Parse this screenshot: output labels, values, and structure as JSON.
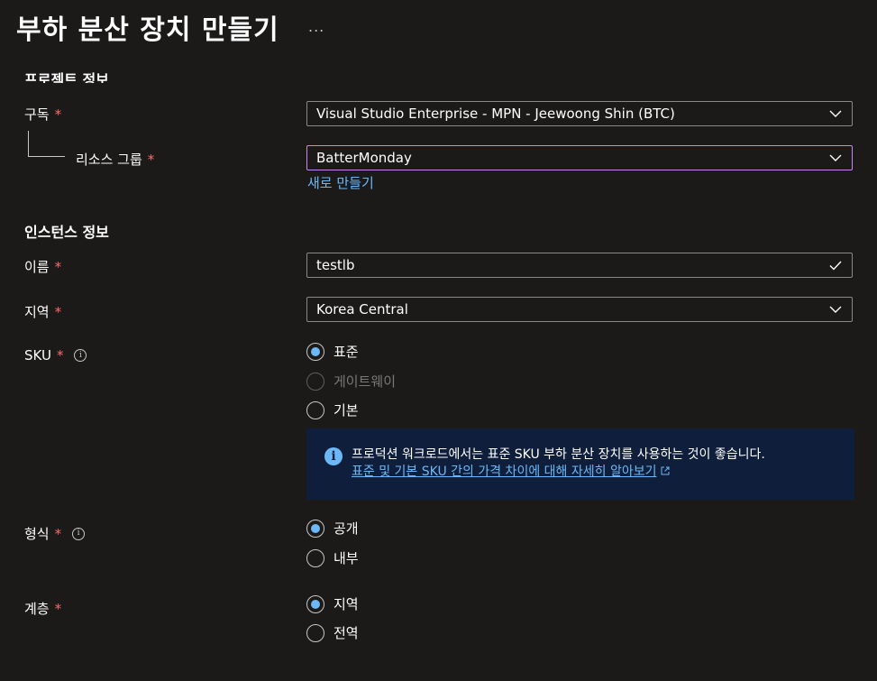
{
  "header": {
    "title": "부하 분산 장치 만들기",
    "more_label": "..."
  },
  "project_section": {
    "heading": "프로젝트 정보",
    "subscription": {
      "label": "구독",
      "required": "*",
      "value": "Visual Studio Enterprise - MPN - Jeewoong Shin (BTC)"
    },
    "resource_group": {
      "label": "리소스 그룹",
      "required": "*",
      "value": "BatterMonday",
      "create_new_label": "새로 만들기"
    }
  },
  "instance_section": {
    "heading": "인스턴스 정보",
    "name": {
      "label": "이름",
      "required": "*",
      "value": "testlb"
    },
    "region": {
      "label": "지역",
      "required": "*",
      "value": "Korea Central"
    },
    "sku": {
      "label": "SKU",
      "required": "*",
      "options": [
        {
          "label": "표준",
          "selected": true,
          "disabled": false
        },
        {
          "label": "게이트웨이",
          "selected": false,
          "disabled": true
        },
        {
          "label": "기본",
          "selected": false,
          "disabled": false
        }
      ],
      "info": {
        "message": "프로덕션 워크로드에서는 표준 SKU 부하 분산 장치를 사용하는 것이 좋습니다.",
        "link_text": "표준 및 기본 SKU 간의 가격 차이에 대해 자세히 알아보기"
      }
    },
    "type": {
      "label": "형식",
      "required": "*",
      "options": [
        {
          "label": "공개",
          "selected": true
        },
        {
          "label": "내부",
          "selected": false
        }
      ]
    },
    "tier": {
      "label": "계층",
      "required": "*",
      "options": [
        {
          "label": "지역",
          "selected": true
        },
        {
          "label": "전역",
          "selected": false
        }
      ]
    }
  },
  "colors": {
    "background": "#1b1a19",
    "accent": "#6cb8f6",
    "required": "#ff6a6a",
    "focus_border": "#c388f2",
    "info_background": "#0f1e3b"
  }
}
